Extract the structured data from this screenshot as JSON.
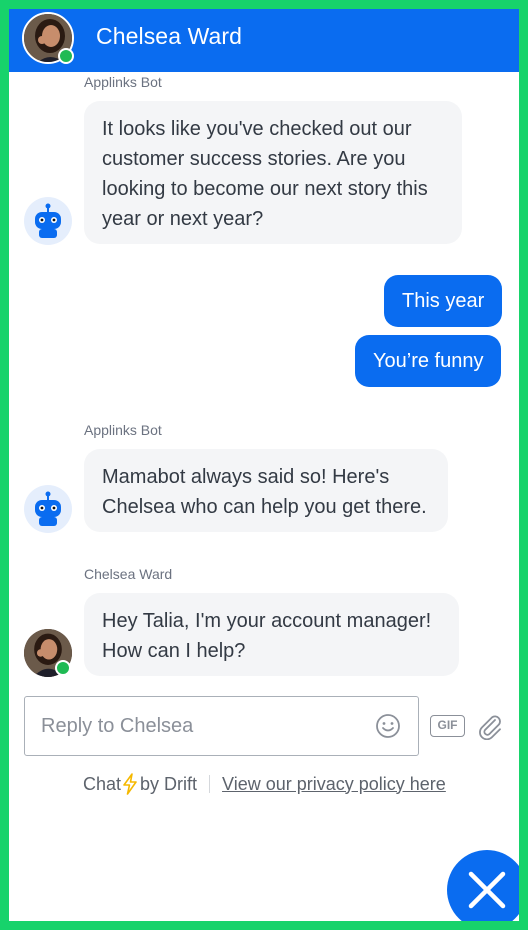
{
  "header": {
    "title": "Chelsea Ward"
  },
  "messages": {
    "bot1": {
      "sender": "Applinks Bot",
      "text": "It looks like you've checked out our customer success stories. Are you looking to become our next story this year or next year?"
    },
    "user1": {
      "text": "This year"
    },
    "user2": {
      "text": "You’re funny"
    },
    "bot2": {
      "sender": "Applinks Bot",
      "text": "Mamabot always said so! Here's Chelsea who can help you get there."
    },
    "agent1": {
      "sender": "Chelsea Ward",
      "text": "Hey Talia, I'm your account manager! How can I help?"
    }
  },
  "composer": {
    "placeholder": "Reply to Chelsea",
    "gif_label": "GIF"
  },
  "footer": {
    "chat_label": "Chat",
    "by_label": "by Drift",
    "privacy_link": "View our privacy policy here"
  },
  "colors": {
    "accent": "#0a6cf0",
    "frame": "#17d36b",
    "online": "#1fba54",
    "bubble_bot": "#f4f5f7"
  },
  "icons": [
    "avatar",
    "online-dot-icon",
    "robot-icon",
    "emoji-icon",
    "gif-icon",
    "paperclip-icon",
    "lightning-icon",
    "close-icon"
  ]
}
